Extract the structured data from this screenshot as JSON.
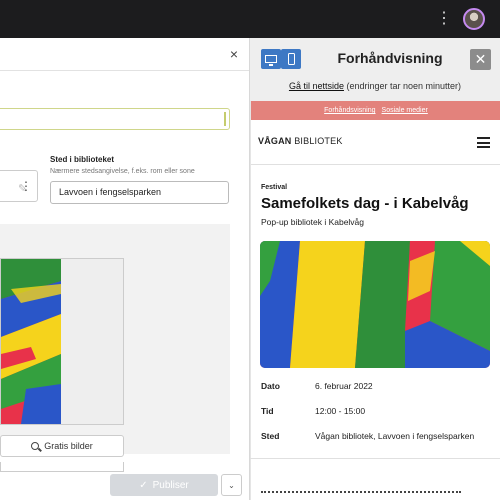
{
  "topbar": {
    "menu_glyph": "⋮",
    "avatar_icon": "avatar"
  },
  "editor": {
    "close_glyph": "×",
    "field_kebab_glyph": "⋮",
    "field_pen_glyph": "✎",
    "place": {
      "label": "Sted i biblioteket",
      "hint": "Nærmere stedsangivelse, f.eks. rom eller sone",
      "value": "Lavvoen i fengselsparken"
    },
    "free_images_label": "Gratis bilder",
    "publish_label": "Publiser",
    "publish_check_glyph": "✓",
    "publish_dropdown_glyph": "⌄"
  },
  "preview": {
    "title": "Forhåndvisning",
    "close_glyph": "✕",
    "goto_link": "Gå til nettside",
    "goto_note": "(endringer tar noen minutter)",
    "tabs": [
      "Forhåndsvisning",
      "Sosiale medier"
    ],
    "site": {
      "logo_bold": "VÅGAN",
      "logo_rest": " BIBLIOTEK",
      "category": "Festival",
      "event_title": "Samefolkets dag - i Kabelvåg",
      "event_subtitle": "Pop-up bibliotek i Kabelvåg",
      "details": [
        {
          "label": "Dato",
          "value": "6. februar 2022"
        },
        {
          "label": "Tid",
          "value": "12:00 - 15:00"
        },
        {
          "label": "Sted",
          "value": "Vågan bibliotek, Lavvoen i fengselsparken"
        }
      ]
    }
  },
  "colors": {
    "accent_blue": "#3d78c4",
    "tab_bar": "#e3827c",
    "topbar": "#1c1c1e"
  }
}
